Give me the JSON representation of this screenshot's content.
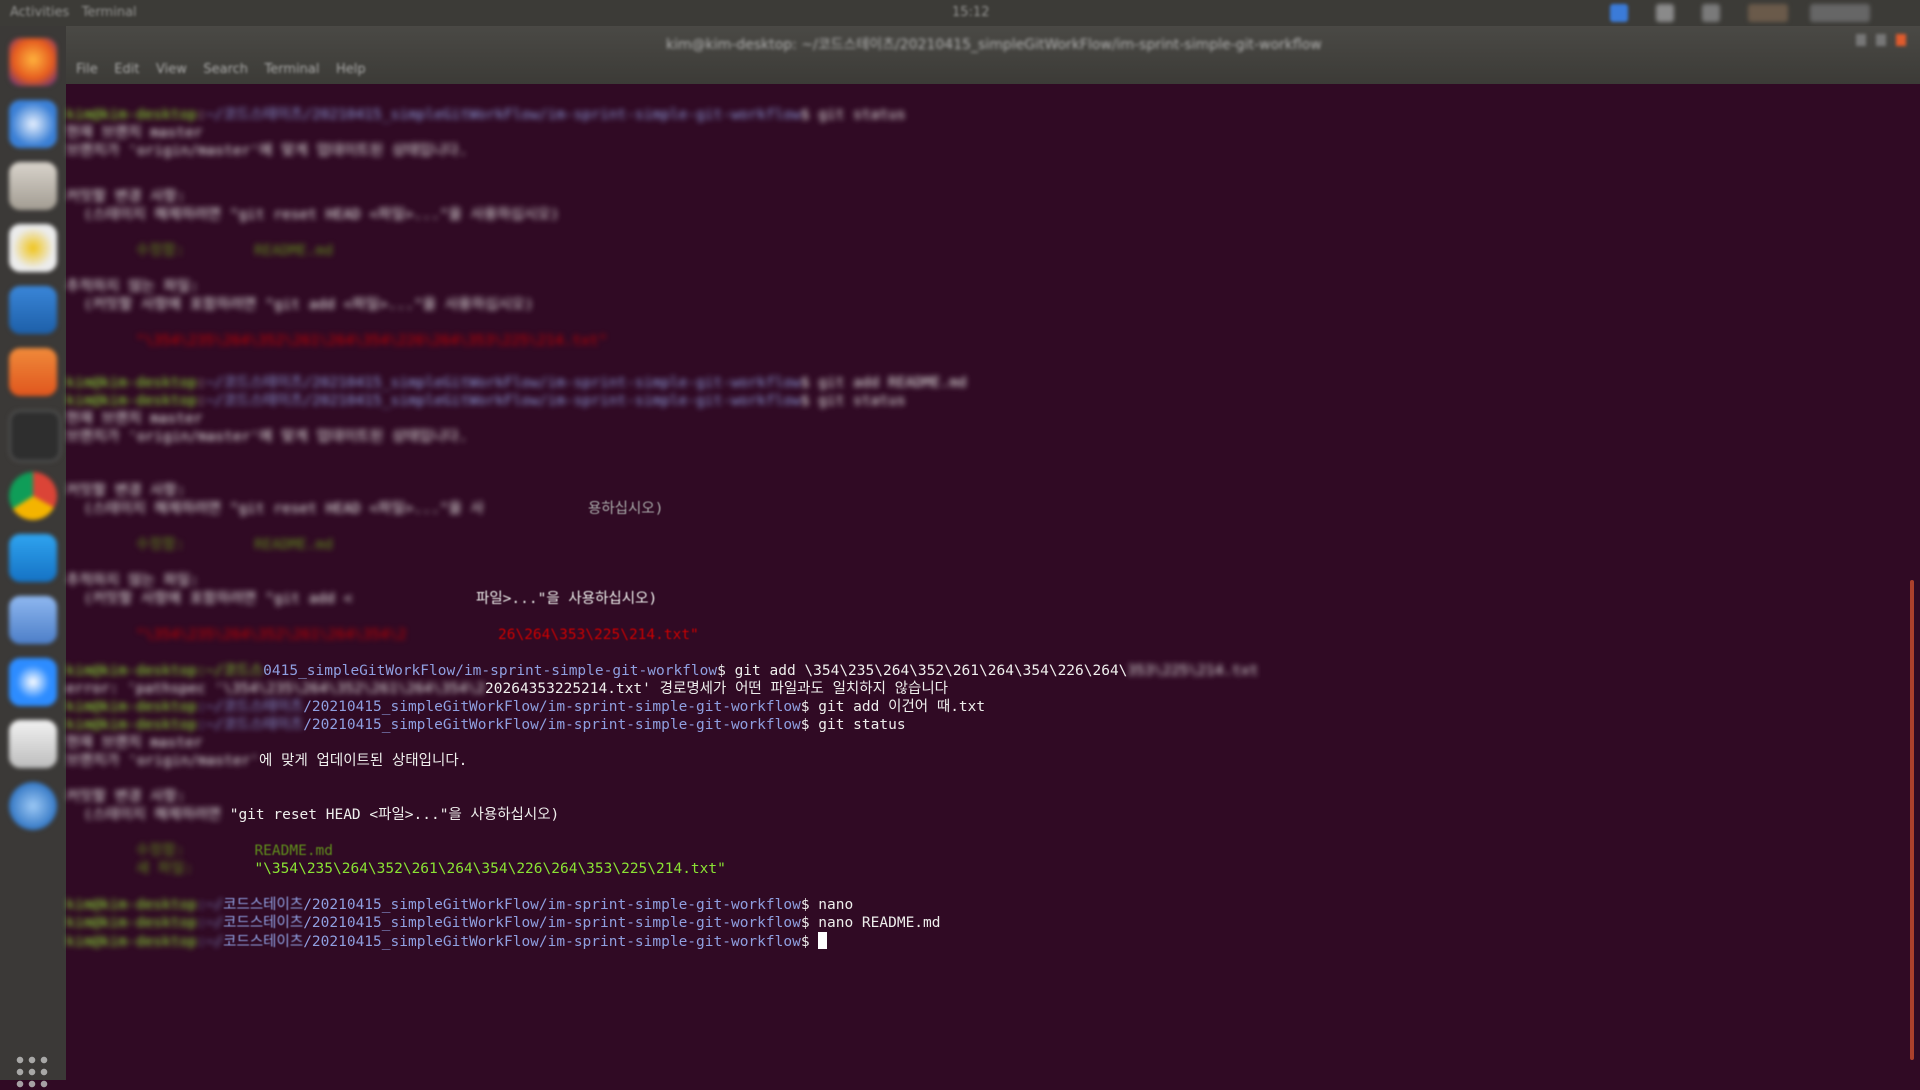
{
  "terminal": {
    "path_suffix": "/20210415_simpleGitWorkFlow/im-sprint-simple-git-workflow",
    "path_partial": "0415_simpleGitWorkFlow/im-sprint-simple-git-workflow",
    "path_korean_prefix": "코드스테이츠",
    "prompt_symbol": "$",
    "cmd_git_add_escaped": " git add \\354\\235\\264\\352\\261\\264\\354\\226\\264\\",
    "error_file_fragment": "20264353225214.txt'",
    "error_message": " 경로명세가 어떤 파일과도 일치하지 않습니다",
    "cmd_git_add_korean": " git add 이건어 때.txt",
    "cmd_git_status": " git status",
    "status_up_to_date": "에 맞게 업데이트된 상태입니다.",
    "hint_reset": "\"git reset HEAD <파일>...\"을 사용하십시오)",
    "staged_file_1": "README.md",
    "staged_file_2": "\"\\354\\235\\264\\352\\261\\264\\354\\226\\264\\353\\225\\214.txt\"",
    "cmd_nano": " nano",
    "cmd_nano_readme": " nano README.md",
    "hint_use_fragment": "파일>...\"을 사용하십시오)",
    "hint_use_fragment_2": "용하십시오)",
    "red_path_fragment": "26\\264\\353\\225\\214.txt\""
  },
  "colors": {
    "background": "#300a24",
    "prompt_user": "#8ae234",
    "prompt_path": "#8f9fe0",
    "text": "#eeeeec",
    "untracked": "#cc0000"
  },
  "dock": {
    "icons": [
      "firefox-icon",
      "thunderbird-icon",
      "files-icon",
      "rhythmbox-icon",
      "libreoffice-writer-icon",
      "software-center-icon",
      "terminal-icon",
      "chrome-icon",
      "vscode-icon",
      "screenshot-icon",
      "zoom-icon",
      "drive-icon",
      "globe-icon",
      "show-apps-icon"
    ]
  }
}
